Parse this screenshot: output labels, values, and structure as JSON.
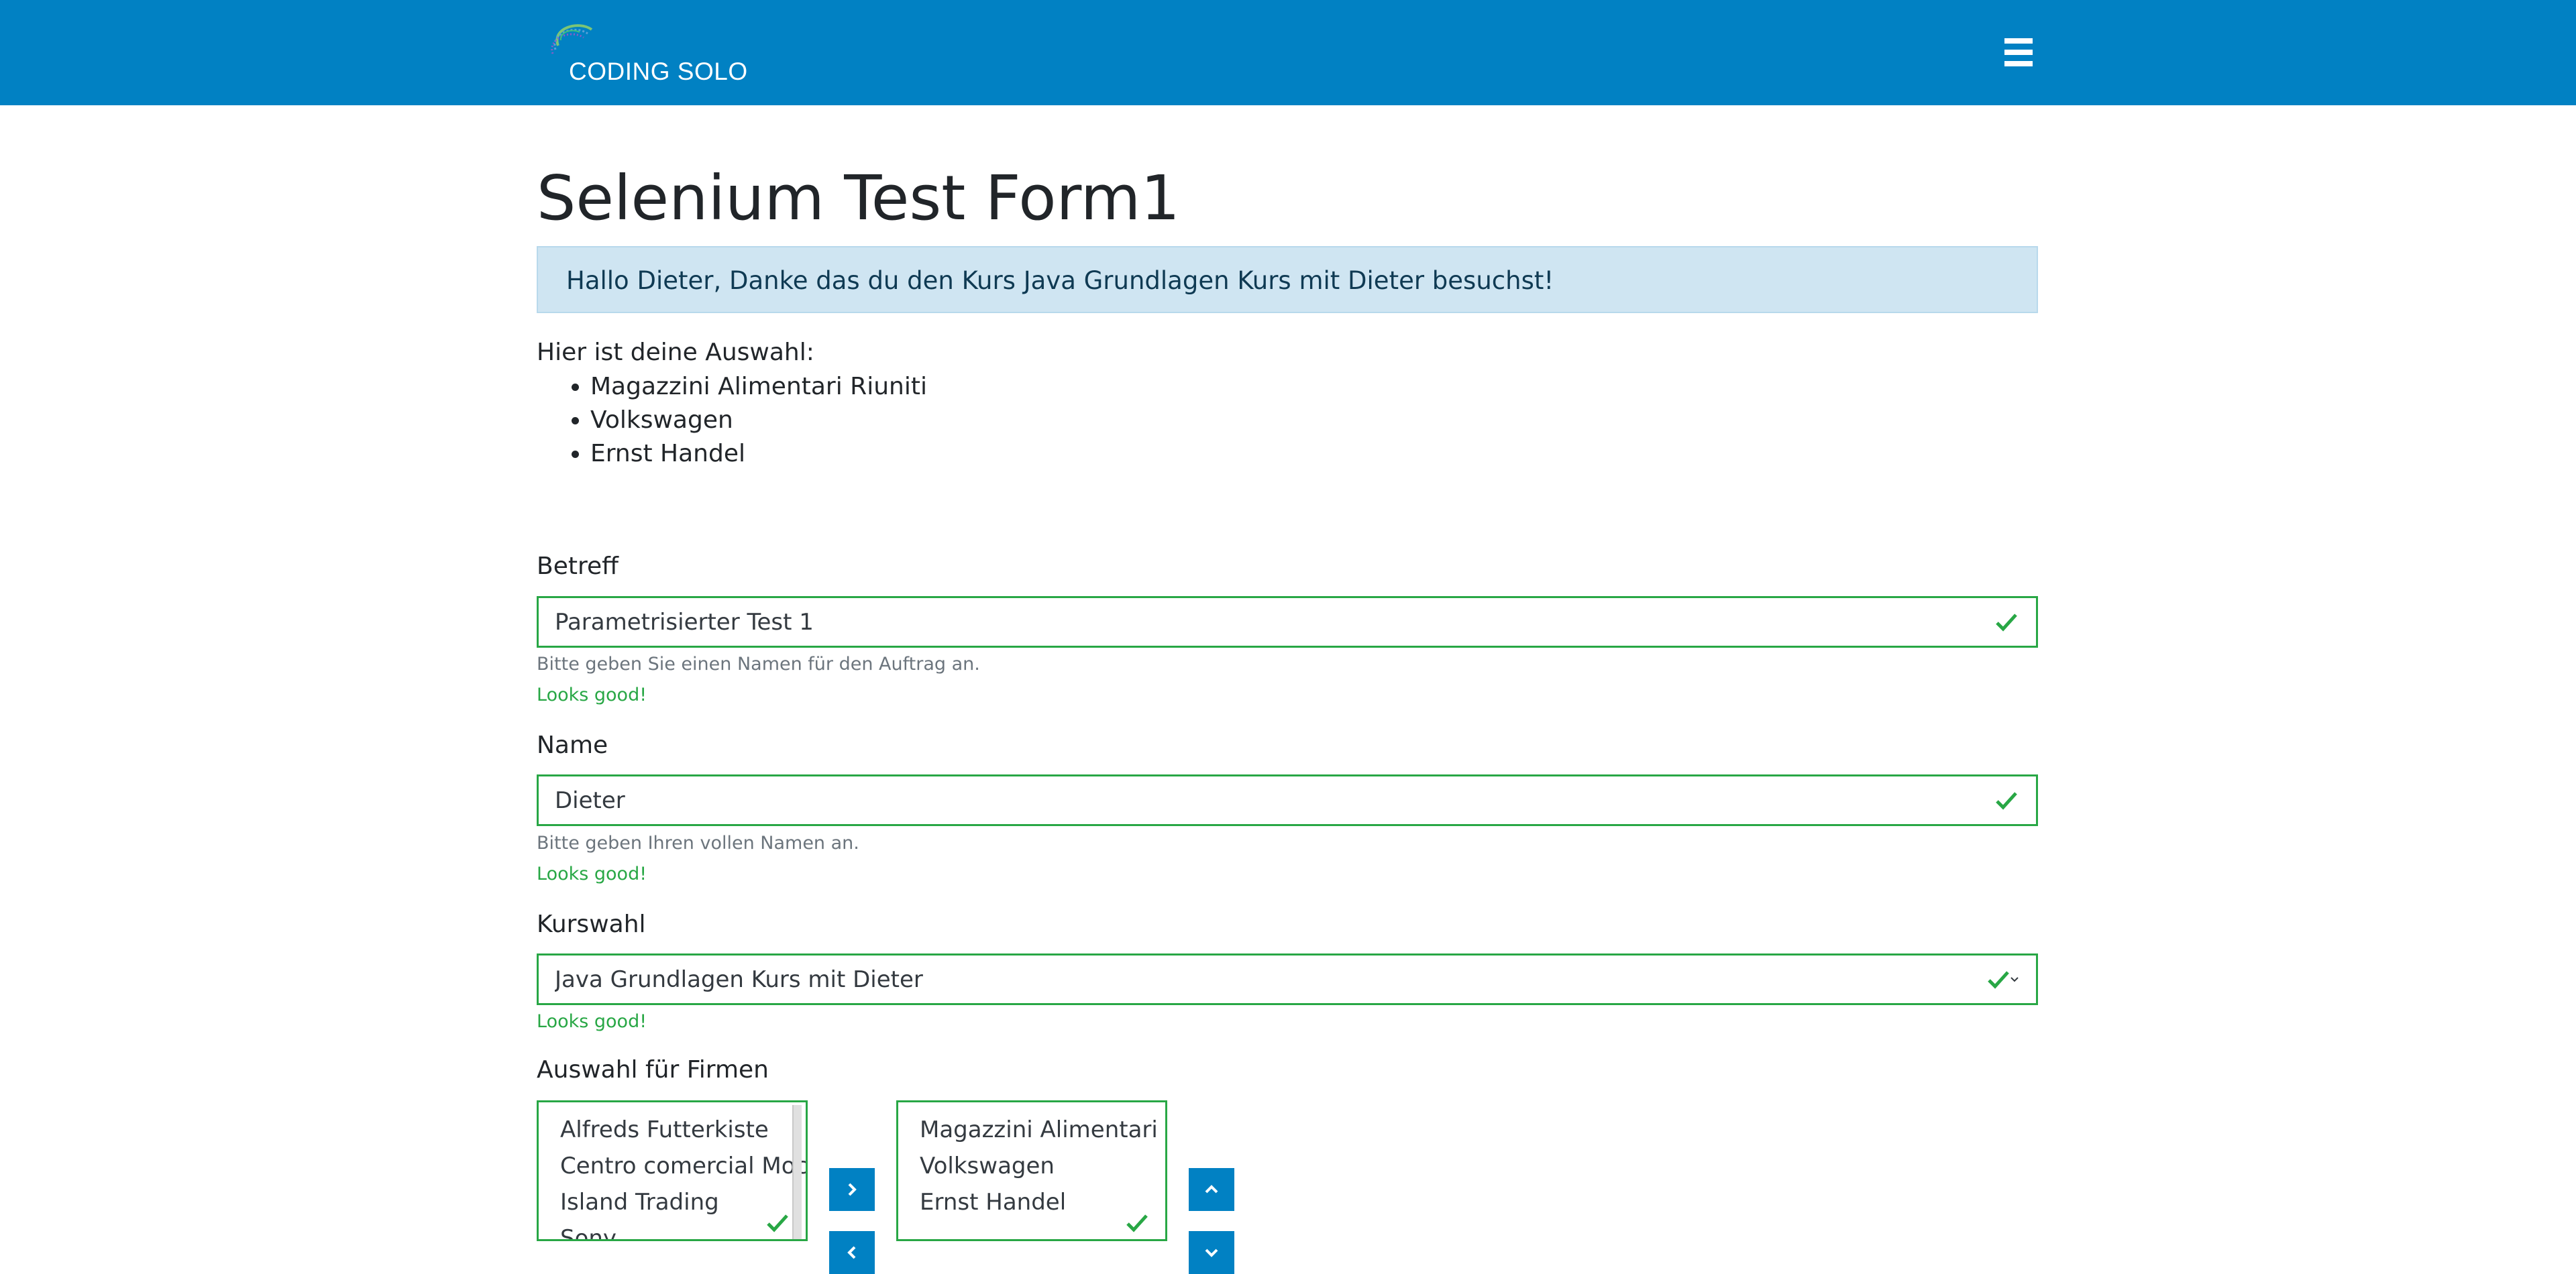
{
  "header": {
    "logo_text": "CODING SOLO",
    "menu_icon": "hamburger-menu-icon",
    "background_color": "#0181c3"
  },
  "main": {
    "title": "Selenium Test Form1",
    "alert": "Hallo Dieter, Danke das du den Kurs Java Grundlagen Kurs mit Dieter besuchst!",
    "selection_label": "Hier ist deine Auswahl:",
    "selection_items": [
      "Magazzini Alimentari Riuniti",
      "Volkswagen",
      "Ernst Handel"
    ]
  },
  "form": {
    "subject": {
      "label": "Betreff",
      "value": "Parametrisierter Test 1",
      "help": "Bitte geben Sie einen Namen für den Auftrag an.",
      "valid": "Looks good!"
    },
    "name": {
      "label": "Name",
      "value": "Dieter",
      "help": "Bitte geben Ihren vollen Namen an.",
      "valid": "Looks good!"
    },
    "course": {
      "label": "Kurswahl",
      "value": "Java Grundlagen Kurs mit Dieter",
      "valid": "Looks good!"
    },
    "companies": {
      "label": "Auswahl für Firmen",
      "available": [
        "Alfreds Futterkiste",
        "Centro comercial Moctezuma",
        "Island Trading",
        "Sony"
      ],
      "selected": [
        "Magazzini Alimentari Riuniti",
        "Volkswagen",
        "Ernst Handel"
      ]
    }
  },
  "colors": {
    "valid": "#28a745",
    "accent": "#0181c3",
    "alert_bg": "#cfe5f2"
  }
}
